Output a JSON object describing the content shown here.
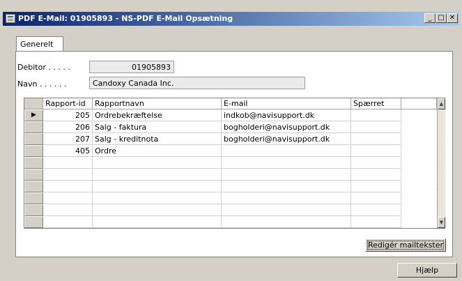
{
  "window": {
    "title": "PDF E-Mail: 01905893 - NS-PDF E-Mail Opsætning"
  },
  "tabs": [
    {
      "label": "Generelt"
    }
  ],
  "fields": {
    "debitor": {
      "label": "Debitor . . . . .",
      "value": "01905893"
    },
    "navn": {
      "label": "Navn . . . . . .",
      "value": "Candoxy Canada Inc."
    }
  },
  "table": {
    "columns": [
      "Rapport-id",
      "Rapportnavn",
      "E-mail",
      "Spærret"
    ],
    "rows": [
      [
        "205",
        "Ordrebekræftelse",
        "indkob@navisupport.dk",
        ""
      ],
      [
        "206",
        "Salg - faktura",
        "bogholderi@navisupport.dk",
        ""
      ],
      [
        "207",
        "Salg - kreditnota",
        "bogholderi@navisupport.dk",
        ""
      ],
      [
        "405",
        "Ordre",
        "",
        ""
      ]
    ]
  },
  "buttons": {
    "edit_mail_texts": "Redigér mailtekster",
    "help": "Hjælp"
  }
}
